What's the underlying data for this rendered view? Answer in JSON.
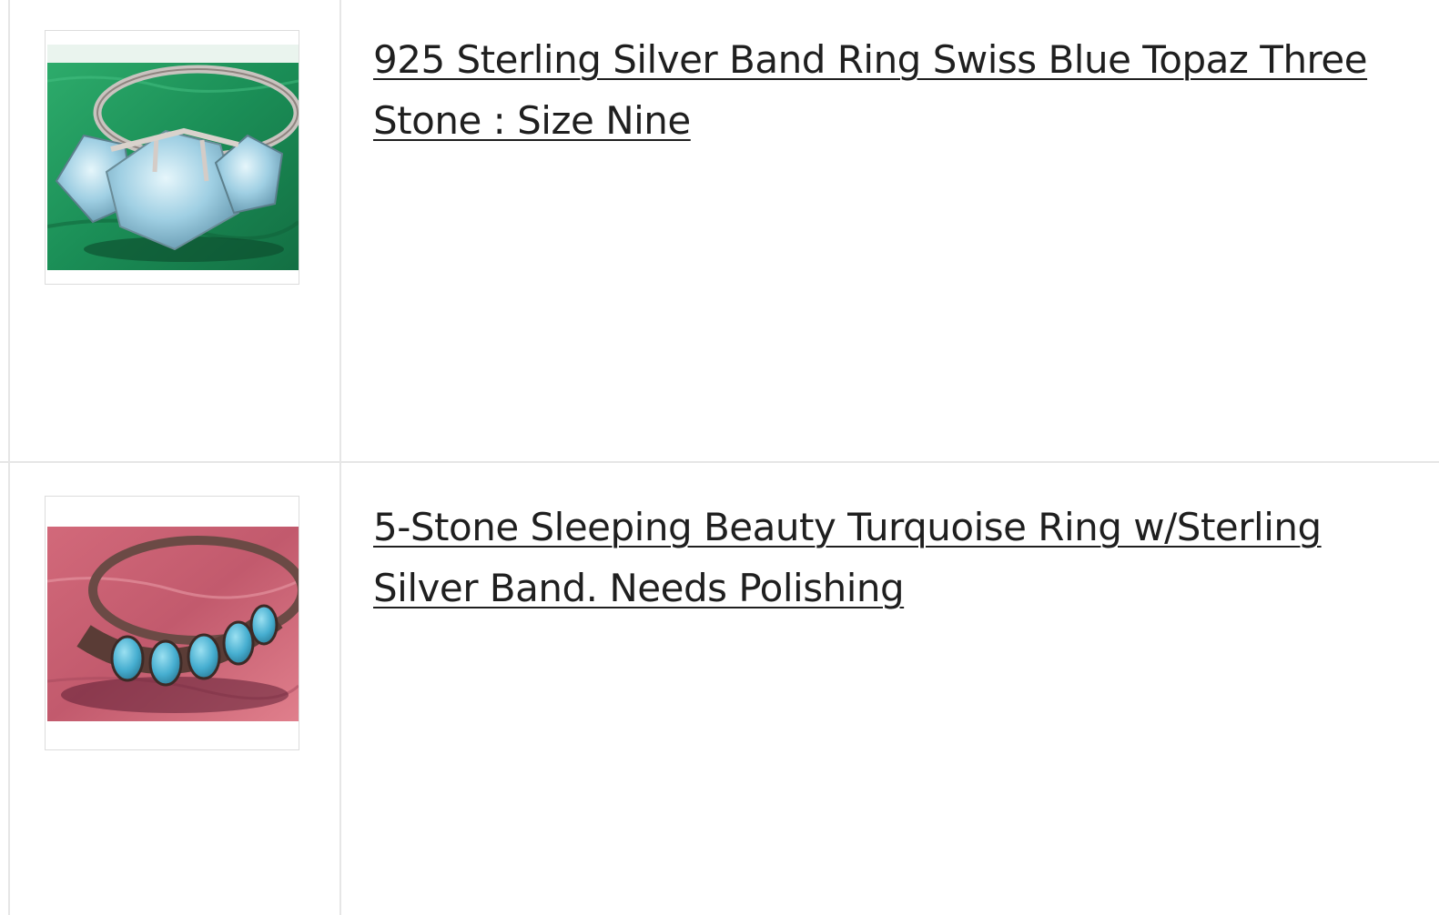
{
  "listings": [
    {
      "title": "925 Sterling Silver Band Ring Swiss Blue Topaz Three Stone : Size Nine",
      "image_icon": "ring-swiss-blue-topaz-photo",
      "image_background_color": "#1f9a5e",
      "stone_color": "#a9d4e8"
    },
    {
      "title": "5-Stone Sleeping Beauty Turquoise Ring w/Sterling Silver Band. Needs Polishing",
      "image_icon": "ring-turquoise-photo",
      "image_background_color": "#c65a6e",
      "stone_color": "#53b8d6"
    }
  ],
  "colors": {
    "divider": "#e6e6e6",
    "title_text": "#1f1f1f"
  }
}
